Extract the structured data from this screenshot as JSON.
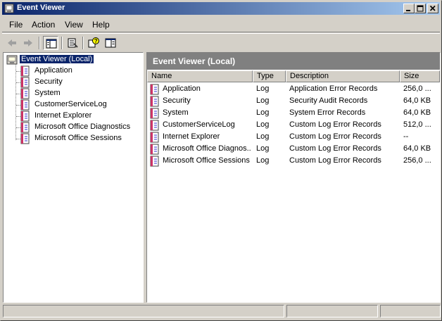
{
  "window": {
    "title": "Event Viewer",
    "icon": "event-viewer-icon",
    "controls": [
      "minimize-icon",
      "maximize-icon",
      "close-icon"
    ]
  },
  "menu": {
    "items": [
      {
        "label": "File"
      },
      {
        "label": "Action"
      },
      {
        "label": "View"
      },
      {
        "label": "Help"
      }
    ]
  },
  "toolbar": {
    "tools": [
      "back-arrow-icon",
      "forward-arrow-icon",
      "show-hide-tree-icon",
      "properties-icon",
      "help-icon",
      "show-hide-action-pane-icon"
    ]
  },
  "tree": {
    "root": "Event Viewer (Local)",
    "items": [
      {
        "label": "Application"
      },
      {
        "label": "Security"
      },
      {
        "label": "System"
      },
      {
        "label": "CustomerServiceLog"
      },
      {
        "label": "Internet Explorer"
      },
      {
        "label": "Microsoft Office Diagnostics"
      },
      {
        "label": "Microsoft Office Sessions"
      }
    ]
  },
  "details": {
    "header": "Event Viewer (Local)",
    "columns": [
      "Name",
      "Type",
      "Description",
      "Size"
    ],
    "rows": [
      {
        "name": "Application",
        "type": "Log",
        "description": "Application Error Records",
        "size": "256,0 ..."
      },
      {
        "name": "Security",
        "type": "Log",
        "description": "Security Audit Records",
        "size": "64,0 KB"
      },
      {
        "name": "System",
        "type": "Log",
        "description": "System Error Records",
        "size": "64,0 KB"
      },
      {
        "name": "CustomerServiceLog",
        "type": "Log",
        "description": "Custom Log Error Records",
        "size": "512,0 ..."
      },
      {
        "name": "Internet Explorer",
        "type": "Log",
        "description": "Custom Log Error Records",
        "size": "--"
      },
      {
        "name": "Microsoft Office Diagnos...",
        "type": "Log",
        "description": "Custom Log Error Records",
        "size": "64,0 KB"
      },
      {
        "name": "Microsoft Office Sessions",
        "type": "Log",
        "description": "Custom Log Error Records",
        "size": "256,0 ..."
      }
    ]
  },
  "colors": {
    "titlebar_start": "#0a246a",
    "titlebar_end": "#a6caf0",
    "selection": "#0a246a",
    "pane_header": "#808080",
    "face": "#d4d0c8"
  }
}
